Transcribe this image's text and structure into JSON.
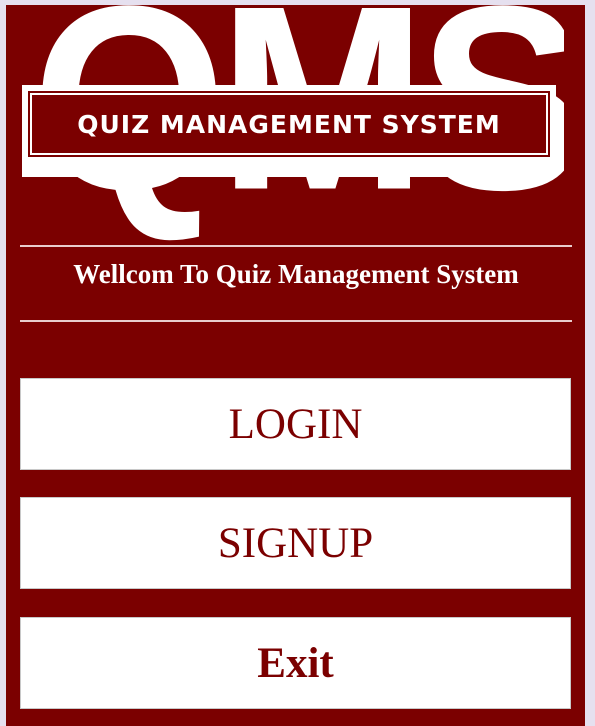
{
  "logo": {
    "watermark": "QMS",
    "title": "QUIZ MANAGEMENT SYSTEM"
  },
  "welcome_text": "Wellcom To Quiz Management System",
  "buttons": {
    "login": "LOGIN",
    "signup": "SIGNUP",
    "exit": "Exit"
  },
  "colors": {
    "background": "#7b0000",
    "button_bg": "#ffffff",
    "button_text": "#7b0000",
    "text": "#ffffff"
  }
}
